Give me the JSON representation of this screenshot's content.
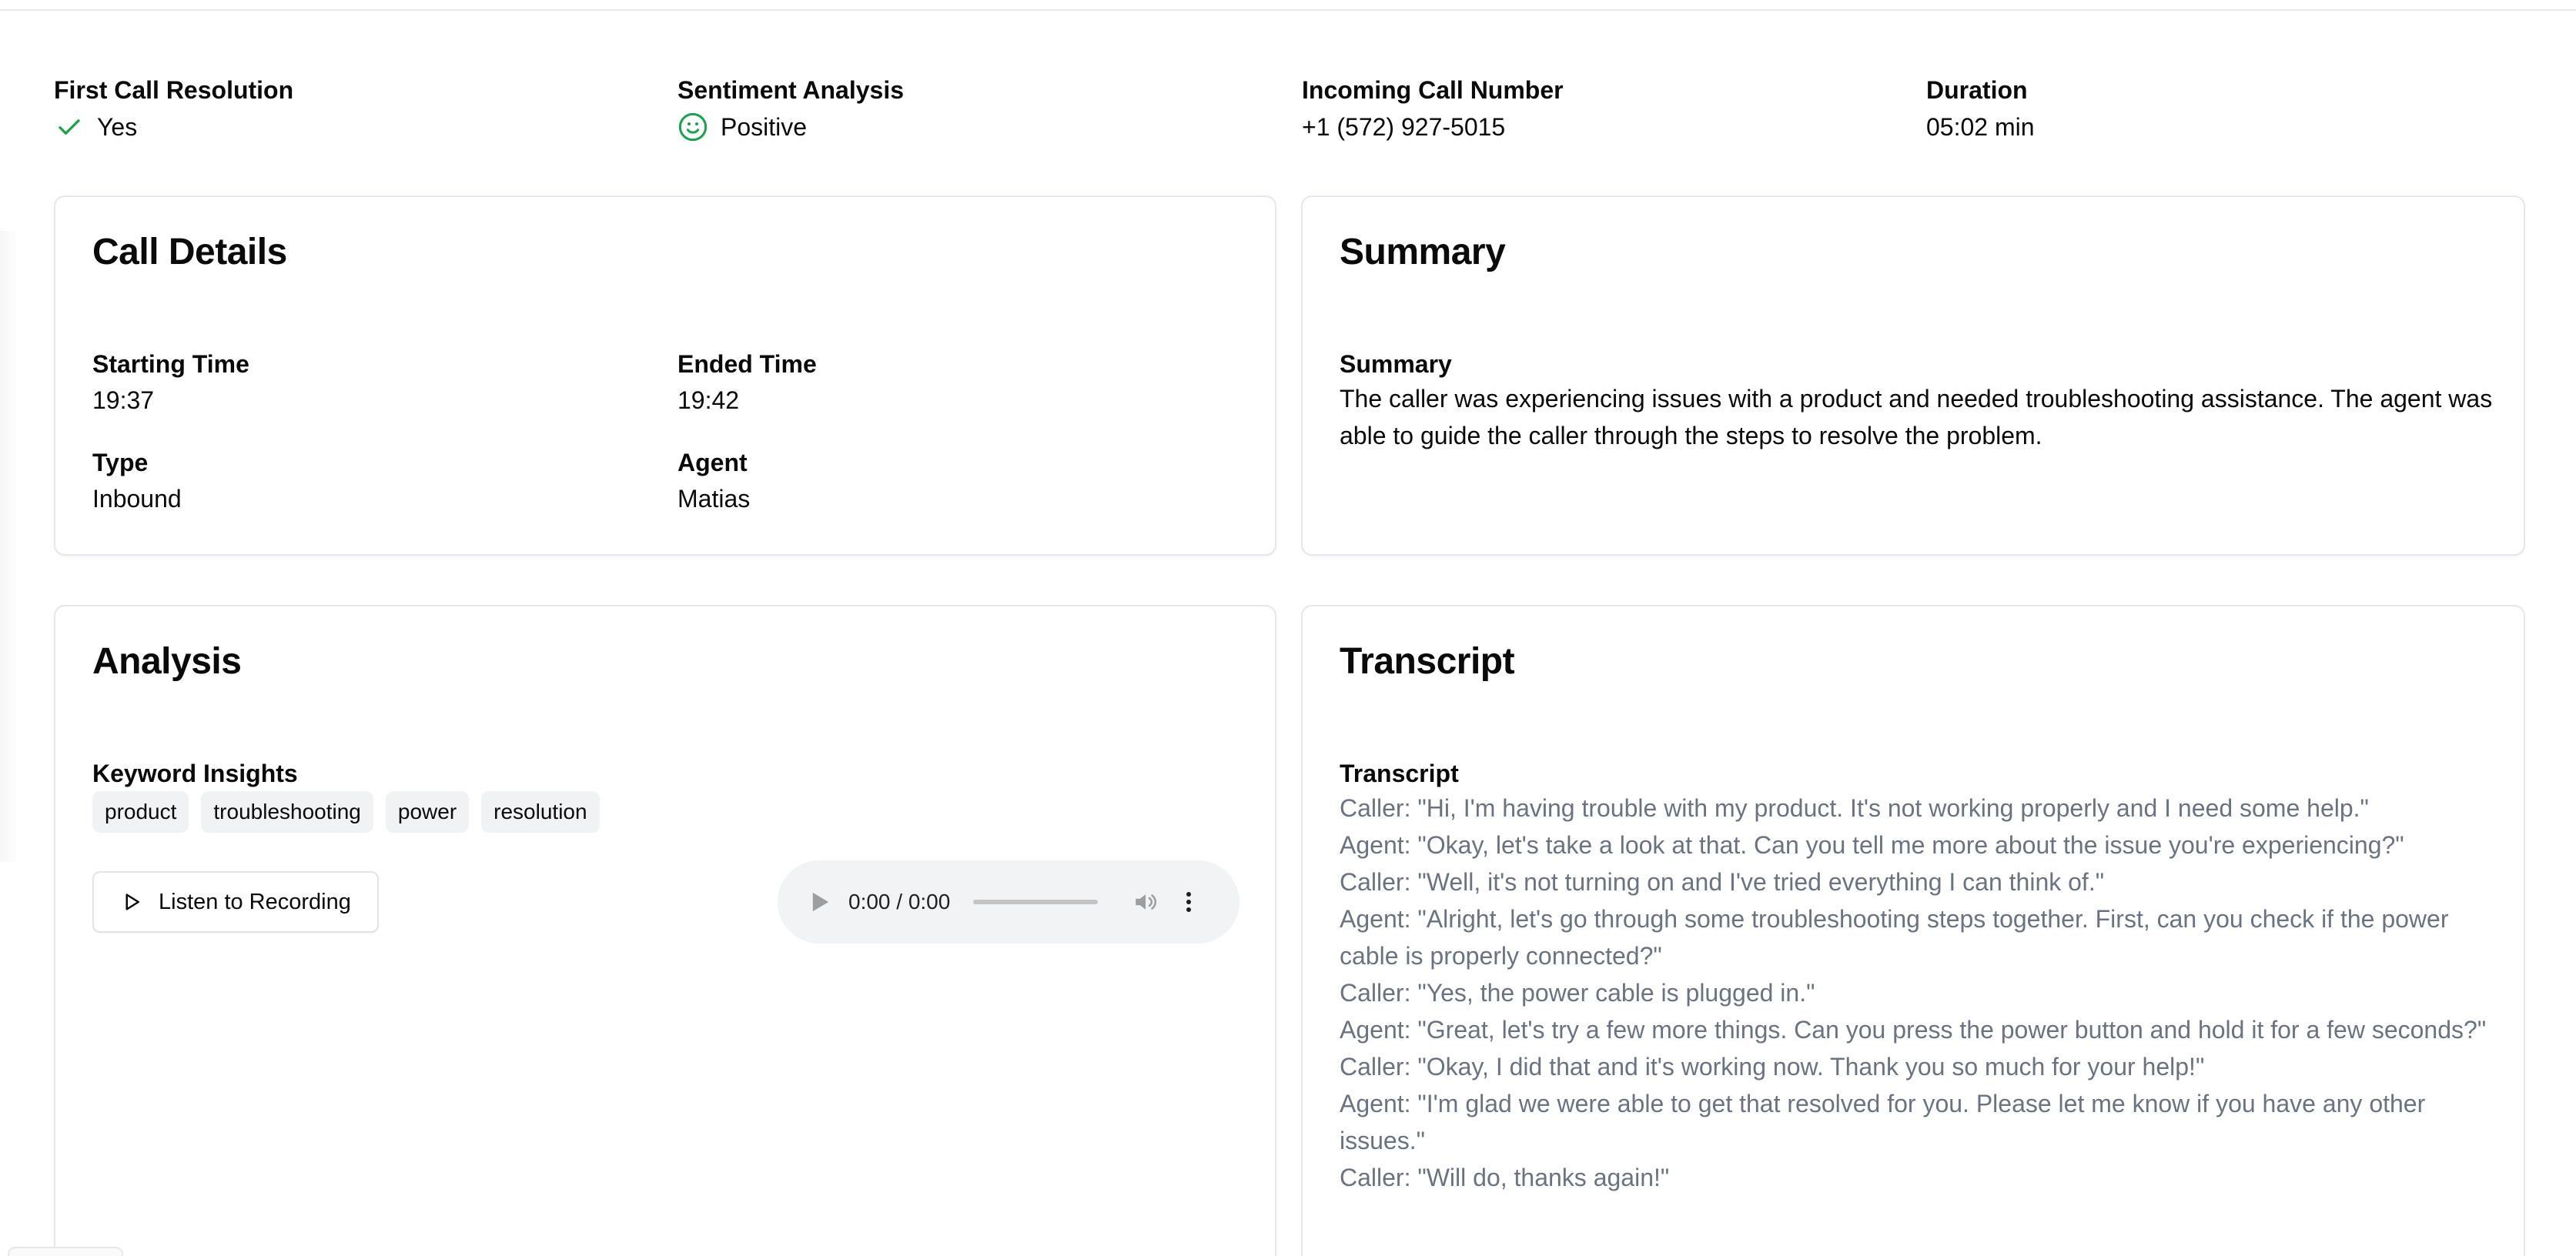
{
  "stats": [
    {
      "label": "First Call Resolution",
      "value": "Yes",
      "icon": "check-icon"
    },
    {
      "label": "Sentiment Analysis",
      "value": "Positive",
      "icon": "smile-icon"
    },
    {
      "label": "Incoming Call Number",
      "value": "+1 (572) 927-5015"
    },
    {
      "label": "Duration",
      "value": "05:02 min"
    }
  ],
  "details": {
    "title": "Call Details",
    "starting_time_label": "Starting Time",
    "starting_time": "19:37",
    "ended_time_label": "Ended Time",
    "ended_time": "19:42",
    "type_label": "Type",
    "type": "Inbound",
    "agent_label": "Agent",
    "agent": "Matias"
  },
  "summary": {
    "title": "Summary",
    "label": "Summary",
    "text": "The caller was experiencing issues with a product and needed troubleshooting assistance. The agent was able to guide the caller through the steps to resolve the problem."
  },
  "analysis": {
    "title": "Analysis",
    "keywords_label": "Keyword Insights",
    "keywords": [
      "product",
      "troubleshooting",
      "power",
      "resolution"
    ],
    "listen_label": "Listen to Recording",
    "audio_time": "0:00 / 0:00"
  },
  "transcript": {
    "title": "Transcript",
    "label": "Transcript",
    "lines": [
      "Caller: \"Hi, I'm having trouble with my product. It's not working properly and I need some help.\"",
      "Agent: \"Okay, let's take a look at that. Can you tell me more about the issue you're experiencing?\"",
      "Caller: \"Well, it's not turning on and I've tried everything I can think of.\"",
      "Agent: \"Alright, let's go through some troubleshooting steps together. First, can you check if the power cable is properly connected?\"",
      "Caller: \"Yes, the power cable is plugged in.\"",
      "Agent: \"Great, let's try a few more things. Can you press the power button and hold it for a few seconds?\"",
      "Caller: \"Okay, I did that and it's working now. Thank you so much for your help!\"",
      "Agent: \"I'm glad we were able to get that resolved for you. Please let me know if you have any other issues.\"",
      "Caller: \"Will do, thanks again!\""
    ]
  },
  "colors": {
    "positive": "#16a34a",
    "border": "#e5e7eb",
    "muted_text": "#6b7280",
    "chip_bg": "#f1f2f4"
  }
}
